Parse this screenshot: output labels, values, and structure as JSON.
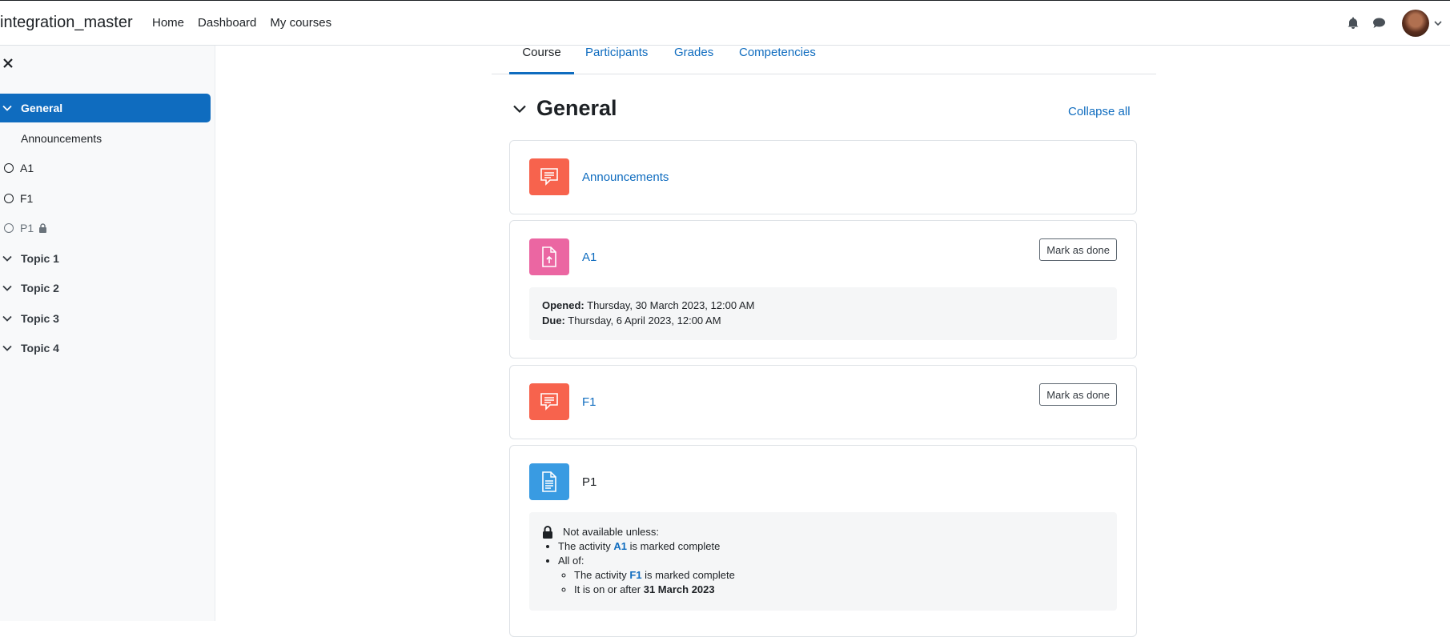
{
  "navbar": {
    "brand": "integration_master",
    "links": [
      "Home",
      "Dashboard",
      "My courses"
    ]
  },
  "drawer": {
    "items": [
      {
        "label": "General",
        "type": "section",
        "active": true
      },
      {
        "label": "Announcements",
        "type": "activity-plain"
      },
      {
        "label": "A1",
        "type": "activity"
      },
      {
        "label": "F1",
        "type": "activity"
      },
      {
        "label": "P1",
        "type": "activity-locked"
      },
      {
        "label": "Topic 1",
        "type": "section"
      },
      {
        "label": "Topic 2",
        "type": "section"
      },
      {
        "label": "Topic 3",
        "type": "section"
      },
      {
        "label": "Topic 4",
        "type": "section"
      }
    ]
  },
  "tabs": [
    "Course",
    "Participants",
    "Grades",
    "Competencies"
  ],
  "section": {
    "title": "General",
    "collapse_all": "Collapse all"
  },
  "activities": {
    "announcements": {
      "name": "Announcements",
      "icon": "forum-icon",
      "color": "#f7634d"
    },
    "a1": {
      "name": "A1",
      "icon": "assignment-icon",
      "color": "#eb66a2",
      "mark_done": "Mark as done",
      "opened_label": "Opened:",
      "opened_value": "Thursday, 30 March 2023, 12:00 AM",
      "due_label": "Due:",
      "due_value": "Thursday, 6 April 2023, 12:00 AM"
    },
    "f1": {
      "name": "F1",
      "icon": "forum-icon",
      "color": "#f7634d",
      "mark_done": "Mark as done"
    },
    "p1": {
      "name": "P1",
      "icon": "page-icon",
      "color": "#399be2",
      "restriction": {
        "header": "Not available unless:",
        "rule1_pre": "The activity",
        "rule1_link": "A1",
        "rule1_post": "is marked complete",
        "rule2": "All of:",
        "rule2a_pre": "The activity",
        "rule2a_link": "F1",
        "rule2a_post": "is marked complete",
        "rule2b_pre": "It is on or after",
        "rule2b_bold": "31 March 2023"
      }
    }
  }
}
